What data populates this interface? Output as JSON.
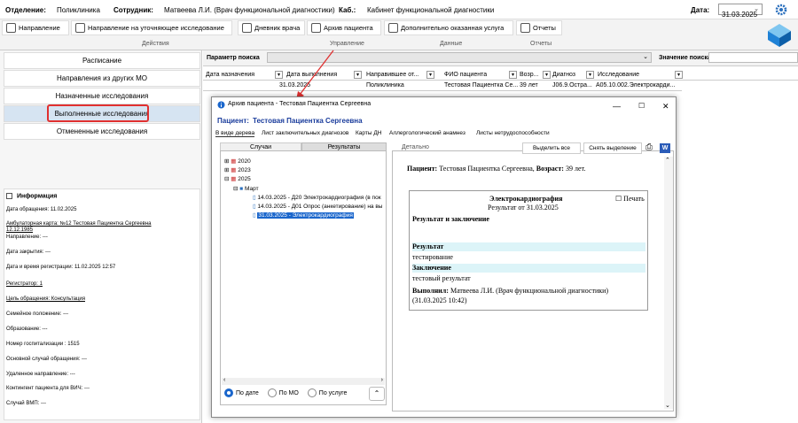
{
  "header": {
    "department_label": "Отделение:",
    "department_value": "Поликлиника",
    "employee_label": "Сотрудник:",
    "employee_value": "Матвеева Л.И. (Врач функциональной диагностики)",
    "cabinet_label": "Каб.:",
    "cabinet_value": "Кабинет функциональной диагностики",
    "date_label": "Дата:",
    "date_value": "31.03.2025"
  },
  "toolbar": {
    "buttons": [
      "Направление",
      "Направление на уточняющее исследование",
      "Дневник врача",
      "Архив пациента",
      "Дополнительно оказанная услуга",
      "Отчеты"
    ],
    "groups": [
      "Действия",
      "Управление",
      "Данные",
      "Отчеты"
    ]
  },
  "left_menu": {
    "title": "Расписание",
    "items": [
      "Направления из других МО",
      "Назначенные исследования",
      "Выполненные исследования",
      "Отмененные исследования"
    ]
  },
  "info": {
    "title": "Информация",
    "lines": [
      "Дата обращения: 11.02.2025",
      "Амбулаторная карта: №12 Тестовая Пациентка Сергеевна",
      "12.12.1985",
      "Направление: ---",
      "Дата закрытия: ---",
      "Дата и время регистрации: 11.02.2025 12:57",
      "Регистратор: 1",
      "Цель обращения: Консультация",
      "Семейное положение: ---",
      "Образование: ---",
      "Номер госпитализации : 1515",
      "Основной случай обращения: ---",
      "Удаленное направление: ---",
      "Контингент пациента для ВИЧ: ---",
      "Случай ВМП: ---"
    ]
  },
  "search": {
    "param_label": "Параметр поиска",
    "value_label": "Значение поиска"
  },
  "table": {
    "columns": [
      "Дата назначения",
      "Дата выполнения",
      "Направившее от...",
      "ФИО пациента",
      "Возр...",
      "Диагноз",
      "Исследование"
    ],
    "row": [
      "31.03.2025",
      "Поликлиника",
      "Тестовая Пациентка Се...",
      "39 лет",
      "J06.9.Остра...",
      "A05.10.002.Электрокарди..."
    ]
  },
  "dialog": {
    "title": "Архив пациента - Тестовая Пациентка Сергеевна",
    "patient_label": "Пациент:",
    "patient_value": "Тестовая Пациентка Сергеевна",
    "tabs": [
      "В виде дерева",
      "Лист заключительных диагнозов",
      "Карты ДН",
      "Аллергологический анамнез",
      "Листы нетрудоспособности"
    ],
    "subtabs": [
      "Случаи",
      "Результаты"
    ],
    "tree": {
      "years": [
        "2020",
        "2023",
        "2025"
      ],
      "month": "Март",
      "records": [
        "14.03.2025 - Д20 Электрокардиография (в пок",
        "14.03.2025 - Д01 Опрос (анкетирование) на вы",
        "31.03.2025 - Электрокардиография"
      ]
    },
    "radios": [
      "По дате",
      "По МО",
      "По услуге"
    ],
    "detail_label": "Детально",
    "select_all": "Выделить все",
    "deselect": "Снять выделение",
    "doc": {
      "patient_line_label": "Пациент:",
      "patient_line_value": "Тестовая Пациентка Сергеевна,",
      "age_label": "Возраст:",
      "age_value": "39 лет.",
      "print_label": "Печать",
      "title": "Электрокардиография",
      "subtitle": "Результат от 31.03.2025",
      "section": "Результат и заключение",
      "result_label": "Результат",
      "result_value": "тестирование",
      "conclusion_label": "Заключение",
      "conclusion_value": "тестовый результат",
      "performed_label": "Выполнил:",
      "performed_value": "Матвеева Л.И. (Врач функциональной диагностики)",
      "performed_date": "(31.03.2025 10:42)"
    }
  },
  "colors": {
    "accent_blue": "#1a3c9c",
    "highlight_red": "#e03030",
    "selection_blue": "#1a66cc",
    "menu_selected": "#d6e4f2",
    "result_band": "#dcf4f8"
  }
}
